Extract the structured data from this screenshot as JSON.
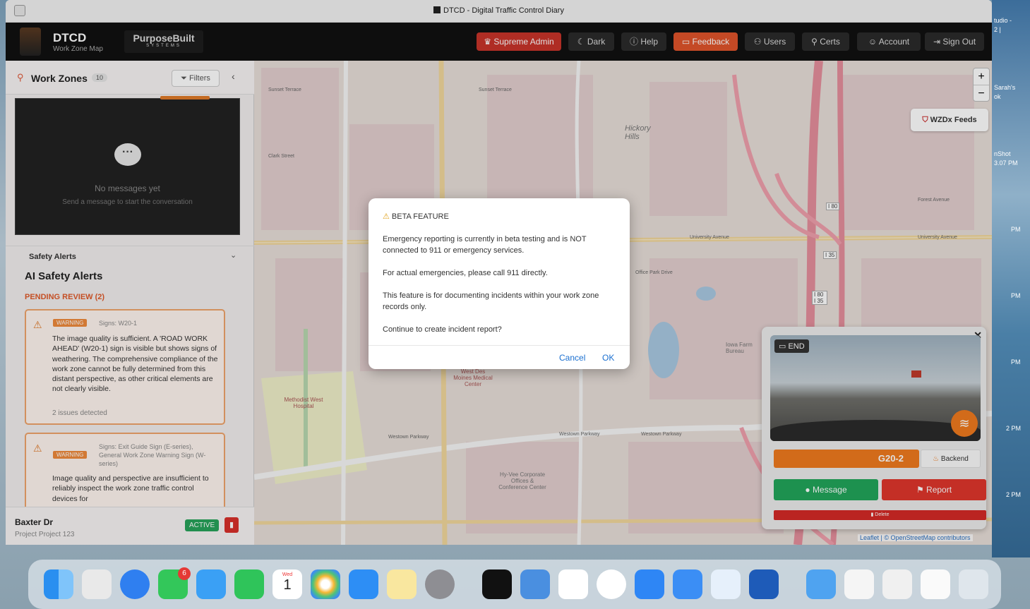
{
  "window": {
    "title": "DTCD - Digital Traffic Control Diary"
  },
  "app": {
    "brand": "DTCD",
    "brand_sub": "Work Zone Map",
    "partner_top": "PurposeBuilt",
    "partner_bottom": "SYSTEMS"
  },
  "nav": {
    "supreme_admin": "Supreme Admin",
    "dark": "Dark",
    "help": "Help",
    "feedback": "Feedback",
    "users": "Users",
    "certs": "Certs",
    "account": "Account",
    "signout": "Sign Out"
  },
  "sidebar": {
    "title": "Work Zones",
    "count": "10",
    "filters": "Filters",
    "chat_empty_title": "No messages yet",
    "chat_empty_sub": "Send a message to start the conversation",
    "safety_section": "Safety Alerts",
    "ai_title": "AI Safety Alerts",
    "pending": "PENDING REVIEW (2)",
    "alerts": [
      {
        "badge": "WARNING",
        "signs": "Signs: W20-1",
        "text": "The image quality is sufficient. A 'ROAD WORK AHEAD' (W20-1) sign is visible but shows signs of weathering. The comprehensive compliance of the work zone cannot be fully determined from this distant perspective, as other critical elements are not clearly visible.",
        "issues": "2 issues detected"
      },
      {
        "badge": "WARNING",
        "signs": "Signs: Exit Guide Sign (E-series), General Work Zone Warning Sign (W-series)",
        "text": "Image quality and perspective are insufficient to reliably inspect the work zone traffic control devices for"
      }
    ],
    "zone_name": "Baxter Dr",
    "zone_project": "Project Project 123",
    "zone_status": "ACTIVE"
  },
  "map": {
    "wzdx": "WZDx Feeds",
    "zoom_in": "+",
    "zoom_out": "−",
    "attribution": "Leaflet | © OpenStreetMap contributors",
    "labels": [
      "Sunset Terrace",
      "Sunset Terrace",
      "Hickory Hills",
      "University Avenue",
      "University Avenue",
      "Forest Avenue",
      "Westown Parkway",
      "Westown Parkway",
      "Westown Parkway",
      "Methodist West Hospital",
      "Iowa Farm Bureau",
      "Hy-Vee Corporate Offices & Conference Center",
      "Clark Street",
      "Office Park Drive",
      "West Des Moines Medical Center",
      "I 80",
      "I 35",
      "I 80 I 35"
    ]
  },
  "camera": {
    "end_label": "END",
    "sign_code": "G20-2",
    "backend": "Backend",
    "message": "Message",
    "report": "Report",
    "delete": "Delete"
  },
  "dialog": {
    "title": "BETA FEATURE",
    "p1": "Emergency reporting is currently in beta testing and is NOT connected to 911 or emergency services.",
    "p2": "For actual emergencies, please call 911 directly.",
    "p3": "This feature is for documenting incidents within your work zone records only.",
    "p4": "Continue to create incident report?",
    "cancel": "Cancel",
    "ok": "OK"
  },
  "desktop": {
    "strip_lines": [
      "tudio -",
      "2 |",
      "Sarah's",
      "ok",
      "nShot",
      "3.07 PM",
      "PM",
      "PM",
      "PM",
      "2 PM",
      "2 PM"
    ],
    "calendar_month": "Wed",
    "calendar_day": "1",
    "messages_badge": "6"
  }
}
